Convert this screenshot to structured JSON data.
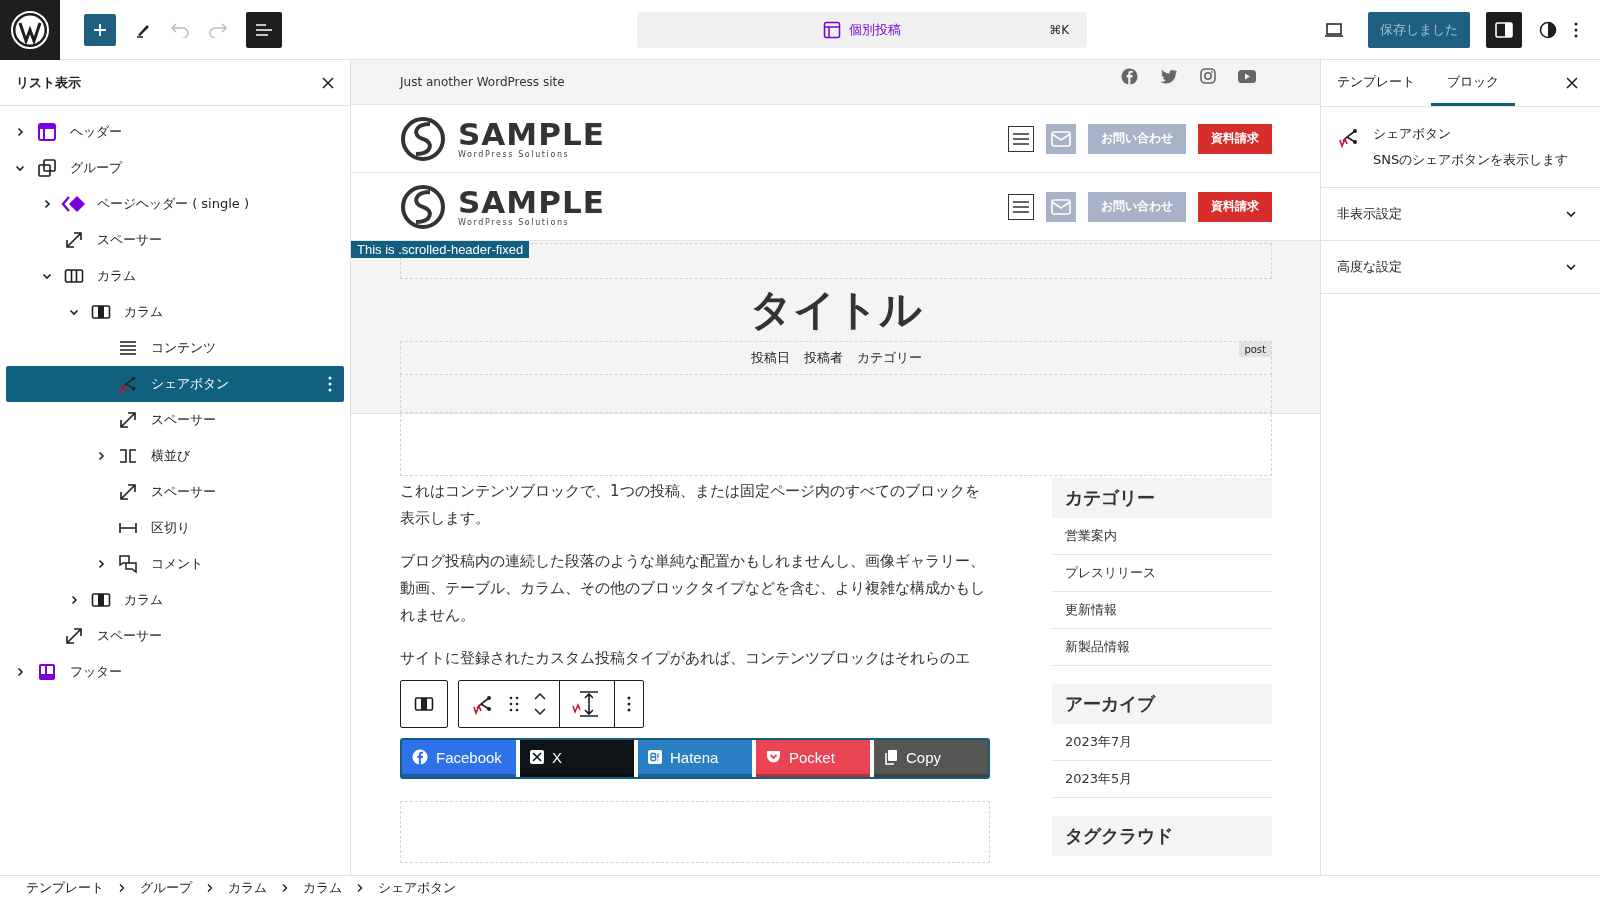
{
  "top_bar": {
    "undo_disabled": true,
    "redo_disabled": true,
    "list_view_on": true,
    "document": {
      "label": "個別投稿",
      "shortcut": "⌘K"
    },
    "save_button": {
      "label": "保存しました",
      "disabled": true
    },
    "settings_on": true
  },
  "list_view": {
    "title": "リスト表示",
    "items": [
      {
        "label": "ヘッダー",
        "kind": "header",
        "expandable": true,
        "expanded": false,
        "selected": false
      },
      {
        "label": "グループ",
        "kind": "group",
        "expandable": true,
        "expanded": true,
        "selected": false,
        "children": [
          {
            "label": "ページヘッダー ( single )",
            "kind": "pattern",
            "expandable": true,
            "expanded": false,
            "selected": false
          },
          {
            "label": "スペーサー",
            "kind": "spacer",
            "expandable": false,
            "selected": false
          },
          {
            "label": "カラム",
            "kind": "columns",
            "expandable": true,
            "expanded": true,
            "selected": false,
            "children": [
              {
                "label": "カラム",
                "kind": "column",
                "expandable": true,
                "expanded": true,
                "selected": false,
                "children": [
                  {
                    "label": "コンテンツ",
                    "kind": "content",
                    "expandable": false,
                    "selected": false
                  },
                  {
                    "label": "シェアボタン",
                    "kind": "share",
                    "expandable": false,
                    "selected": true
                  },
                  {
                    "label": "スペーサー",
                    "kind": "spacer",
                    "expandable": false,
                    "selected": false
                  },
                  {
                    "label": "横並び",
                    "kind": "row",
                    "expandable": true,
                    "expanded": false,
                    "selected": false
                  },
                  {
                    "label": "スペーサー",
                    "kind": "spacer",
                    "expandable": false,
                    "selected": false
                  },
                  {
                    "label": "区切り",
                    "kind": "separator",
                    "expandable": false,
                    "selected": false
                  },
                  {
                    "label": "コメント",
                    "kind": "comments",
                    "expandable": true,
                    "expanded": false,
                    "selected": false
                  }
                ]
              },
              {
                "label": "カラム",
                "kind": "column",
                "expandable": true,
                "expanded": false,
                "selected": false
              }
            ]
          },
          {
            "label": "スペーサー",
            "kind": "spacer",
            "expandable": false,
            "selected": false
          }
        ]
      },
      {
        "label": "フッター",
        "kind": "footer",
        "expandable": true,
        "expanded": false,
        "selected": false
      }
    ]
  },
  "canvas": {
    "site_tagline": "Just another WordPress site",
    "site_headers": [
      {
        "logo_text": "SAMPLE",
        "logo_subtitle": "WordPress Solutions",
        "buttons": [
          {
            "label": "お問い合わせ",
            "kind": "contact"
          },
          {
            "label": "資料請求",
            "kind": "request"
          }
        ]
      },
      {
        "logo_text": "SAMPLE",
        "logo_subtitle": "WordPress Solutions",
        "buttons": [
          {
            "label": "お問い合わせ",
            "kind": "contact"
          },
          {
            "label": "資料請求",
            "kind": "request"
          }
        ]
      }
    ],
    "debug_label": "This is .scrolled-header-fixed",
    "page_header": {
      "title": "タイトル",
      "meta": [
        "投稿日",
        "投稿者",
        "カテゴリー"
      ],
      "tag": "post"
    },
    "paragraphs": [
      "これはコンテンツブロックで、1つの投稿、または固定ページ内のすべてのブロックを表示します。",
      "ブログ投稿内の連続した段落のような単純な配置かもしれませんし、画像ギャラリー、動画、テーブル、カラム、その他のブロックタイプなどを含む、より複雑な構成かもしれません。",
      "サイトに登録されたカスタム投稿タイプがあれば、コンテンツブロックはそれらのエ"
    ],
    "share_buttons": [
      {
        "label": "Facebook",
        "kind": "facebook",
        "color": "#2d72e8"
      },
      {
        "label": "X",
        "kind": "x",
        "color": "#0f1419"
      },
      {
        "label": "Hatena",
        "kind": "hatena",
        "color": "#2a7fc4"
      },
      {
        "label": "Pocket",
        "kind": "pocket",
        "color": "#e94454"
      },
      {
        "label": "Copy",
        "kind": "copy",
        "color": "#555555"
      }
    ],
    "widgets": [
      {
        "title": "カテゴリー",
        "items": [
          "営業案内",
          "プレスリリース",
          "更新情報",
          "新製品情報"
        ]
      },
      {
        "title": "アーカイブ",
        "items": [
          "2023年7月",
          "2023年5月"
        ]
      },
      {
        "title": "タグクラウド"
      }
    ]
  },
  "settings": {
    "tabs": [
      {
        "label": "テンプレート",
        "selected": false
      },
      {
        "label": "ブロック",
        "selected": true
      }
    ],
    "block_card": {
      "title": "シェアボタン",
      "description": "SNSのシェアボタンを表示します"
    },
    "panels": [
      {
        "label": "非表示設定",
        "expanded": false
      },
      {
        "label": "高度な設定",
        "expanded": false
      }
    ]
  },
  "breadcrumb": [
    "テンプレート",
    "グループ",
    "カラム",
    "カラム",
    "シェアボタン"
  ]
}
